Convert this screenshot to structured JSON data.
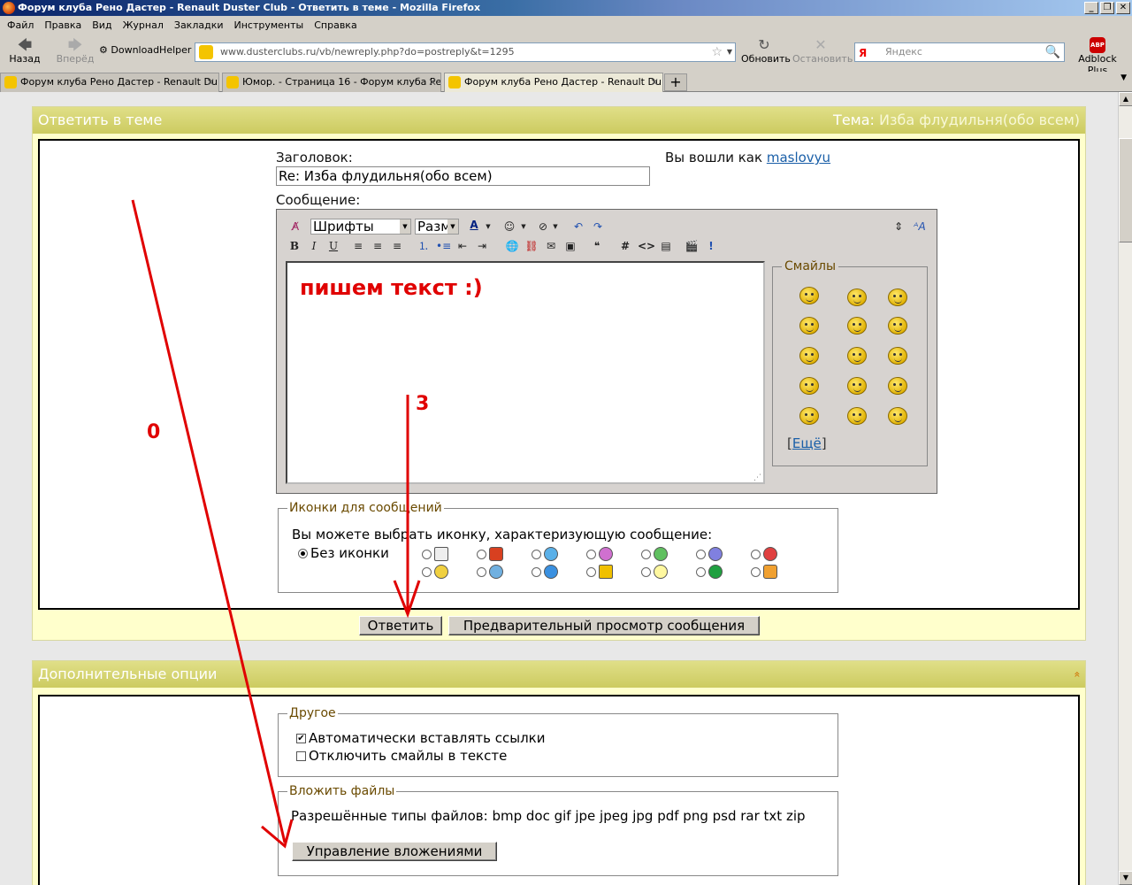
{
  "window": {
    "title": "Форум клуба Рено Дастер - Renault Duster Club - Ответить в теме - Mozilla Firefox",
    "controls": [
      "_",
      "❐",
      "✕"
    ]
  },
  "menu": [
    "Файл",
    "Правка",
    "Вид",
    "Журнал",
    "Закладки",
    "Инструменты",
    "Справка"
  ],
  "nav": {
    "back": "Назад",
    "forward": "Вперёд",
    "downloadhelper": "DownloadHelper",
    "url": "www.dusterclubs.ru/vb/newreply.php?do=postreply&t=1295",
    "reload": "Обновить",
    "stop": "Остановить",
    "search_placeholder": "Яндекс",
    "search_engine": "Я",
    "adblock": "Adblock Plus",
    "adblock_badge": "ABP"
  },
  "tabs": [
    {
      "label": "Форум клуба Рено Дастер - Renault Du...",
      "active": false
    },
    {
      "label": "Юмор. - Страница 16 - Форум клуба Ре...",
      "active": false
    },
    {
      "label": "Форум клуба Рено Дастер - Renault Du...",
      "active": true
    }
  ],
  "reply_panel": {
    "header": "Ответить в теме",
    "topic_label": "Тема:",
    "topic_value": "Изба флудильня(обо всем)",
    "title_label": "Заголовок:",
    "title_value": "Re: Изба флудильня(обо всем)",
    "logged_in_label": "Вы вошли как",
    "username": "maslovyu",
    "message_label": "Сообщение:",
    "font_select": "Шрифты",
    "size_select": "Разм",
    "message_text": "пишем текст :)",
    "smilies_legend": "Смайлы",
    "more_smilies_open": "[",
    "more_smilies": "Ещё",
    "more_smilies_close": "]",
    "post_icons_legend": "Иконки для сообщений",
    "post_icons_hint": "Вы можете выбрать иконку, характеризующую сообщение:",
    "no_icon": "Без иконки",
    "submit": "Ответить",
    "preview": "Предварительный просмотр сообщения"
  },
  "options_panel": {
    "header": "Дополнительные опции",
    "collapse_icon": "»",
    "other_legend": "Другое",
    "auto_links": "Автоматически вставлять ссылки",
    "auto_links_checked": true,
    "disable_smilies": "Отключить смайлы в тексте",
    "disable_smilies_checked": false,
    "attach_legend": "Вложить файлы",
    "allowed_types": "Разрешённые типы файлов: bmp doc gif jpe jpeg jpg pdf png psd rar txt zip",
    "manage_attachments": "Управление вложениями"
  },
  "annotations": {
    "label_0": "0",
    "label_3": "3",
    "color": "#e00000"
  }
}
